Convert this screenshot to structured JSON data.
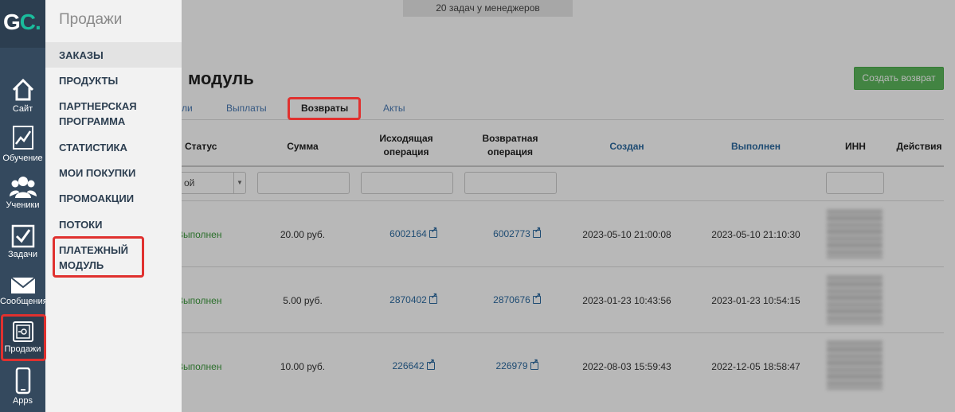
{
  "logo": {
    "g": "G",
    "c": "C",
    "dot": "."
  },
  "rail": [
    {
      "label": "Сайт",
      "icon": "home-icon"
    },
    {
      "label": "Обучение",
      "icon": "chart-icon"
    },
    {
      "label": "Ученики",
      "icon": "users-icon"
    },
    {
      "label": "Задачи",
      "icon": "checkbox-icon"
    },
    {
      "label": "Сообщения",
      "icon": "mail-icon"
    },
    {
      "label": "Продажи",
      "icon": "safe-icon"
    },
    {
      "label": "Apps",
      "icon": "phone-icon"
    }
  ],
  "submenu": {
    "title": "Продажи",
    "items": [
      {
        "label": "ЗАКАЗЫ"
      },
      {
        "label": "ПРОДУКТЫ"
      },
      {
        "label": "ПАРТНЕРСКАЯ ПРОГРАММА"
      },
      {
        "label": "СТАТИСТИКА"
      },
      {
        "label": "МОИ ПОКУПКИ"
      },
      {
        "label": "ПРОМОАКЦИИ"
      },
      {
        "label": "ПОТОКИ"
      },
      {
        "label": "ПЛАТЕЖНЫЙ МОДУЛЬ"
      }
    ]
  },
  "header": {
    "tasks": "20 задач у менеджеров",
    "title": "модуль",
    "create_button": "Создать возврат"
  },
  "tabs": [
    "ли",
    "Выплаты",
    "Возвраты",
    "Акты"
  ],
  "columns": {
    "status": "Статус",
    "sum": "Сумма",
    "source": "Исходящая операция",
    "refund": "Возвратная операция",
    "created": "Создан",
    "done": "Выполнен",
    "inn": "ИНН",
    "actions": "Действия"
  },
  "filters": {
    "status_value": "ой",
    "arrow": "▼"
  },
  "rows": [
    {
      "status": "Выполнен",
      "sum": "20.00 руб.",
      "source": "6002164",
      "refund": "6002773",
      "created": "2023-05-10 21:00:08",
      "done": "2023-05-10 21:10:30"
    },
    {
      "status": "Выполнен",
      "sum": "5.00 руб.",
      "source": "2870402",
      "refund": "2870676",
      "created": "2023-01-23 10:43:56",
      "done": "2023-01-23 10:54:15"
    },
    {
      "status": "Выполнен",
      "sum": "10.00 руб.",
      "source": "226642",
      "refund": "226979",
      "created": "2022-08-03 15:59:43",
      "done": "2022-12-05 18:58:47"
    }
  ],
  "colors": {
    "highlight": "#e0312f",
    "rail": "#34495e",
    "accent": "#1abc9c",
    "success": "#5cb85c"
  }
}
